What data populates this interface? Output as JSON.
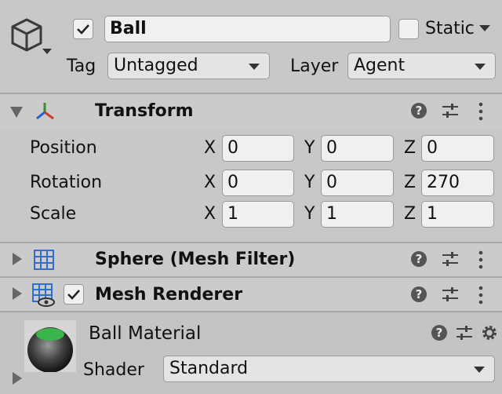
{
  "object": {
    "name": "Ball",
    "active_checked": true,
    "static_label": "Static",
    "static_checked": false,
    "tag_label": "Tag",
    "tag_value": "Untagged",
    "layer_label": "Layer",
    "layer_value": "Agent"
  },
  "transform": {
    "title": "Transform",
    "rows": [
      {
        "label": "Position",
        "x": "0",
        "y": "0",
        "z": "0"
      },
      {
        "label": "Rotation",
        "x": "0",
        "y": "0",
        "z": "270"
      },
      {
        "label": "Scale",
        "x": "1",
        "y": "1",
        "z": "1"
      }
    ],
    "axis_x": "X",
    "axis_y": "Y",
    "axis_z": "Z"
  },
  "mesh_filter": {
    "title": "Sphere (Mesh Filter)"
  },
  "mesh_renderer": {
    "title": "Mesh Renderer",
    "checked": true
  },
  "material": {
    "name": "Ball Material",
    "shader_label": "Shader",
    "shader_value": "Standard"
  },
  "icons": {
    "gameobject": "cube-icon",
    "transform": "transform-axes-icon",
    "mesh_filter": "mesh-grid-icon",
    "mesh_renderer": "mesh-renderer-icon",
    "help": "help-icon",
    "presets": "sliders-icon",
    "menu": "kebab-menu-icon",
    "settings": "gear-icon"
  }
}
